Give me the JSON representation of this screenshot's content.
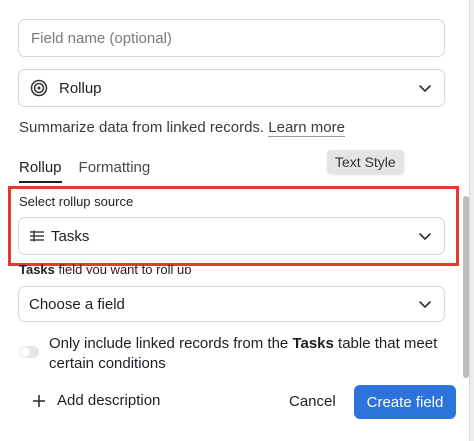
{
  "field_name": {
    "placeholder": "Field name (optional)"
  },
  "field_type": {
    "selected": "Rollup",
    "icon": "rollup-icon"
  },
  "description": {
    "text": "Summarize data from linked records.",
    "link": "Learn more"
  },
  "tabs": [
    {
      "label": "Rollup",
      "active": true
    },
    {
      "label": "Formatting",
      "active": false
    }
  ],
  "tooltip": "Text Style",
  "rollup_source": {
    "label": "Select rollup source",
    "value": "Tasks",
    "icon": "table-lines-icon"
  },
  "field_select": {
    "label_bold": "Tasks",
    "label_rest": " field you want to roll up",
    "value": "Choose a field"
  },
  "condition": {
    "part1": "Only include linked records from the ",
    "bold": "Tasks",
    "part2": " table that meet certain conditions",
    "enabled": false
  },
  "footer": {
    "add_description": "Add description",
    "cancel": "Cancel",
    "create": "Create field"
  },
  "colors": {
    "accent": "#2d74da",
    "highlight": "#e03b2b"
  }
}
